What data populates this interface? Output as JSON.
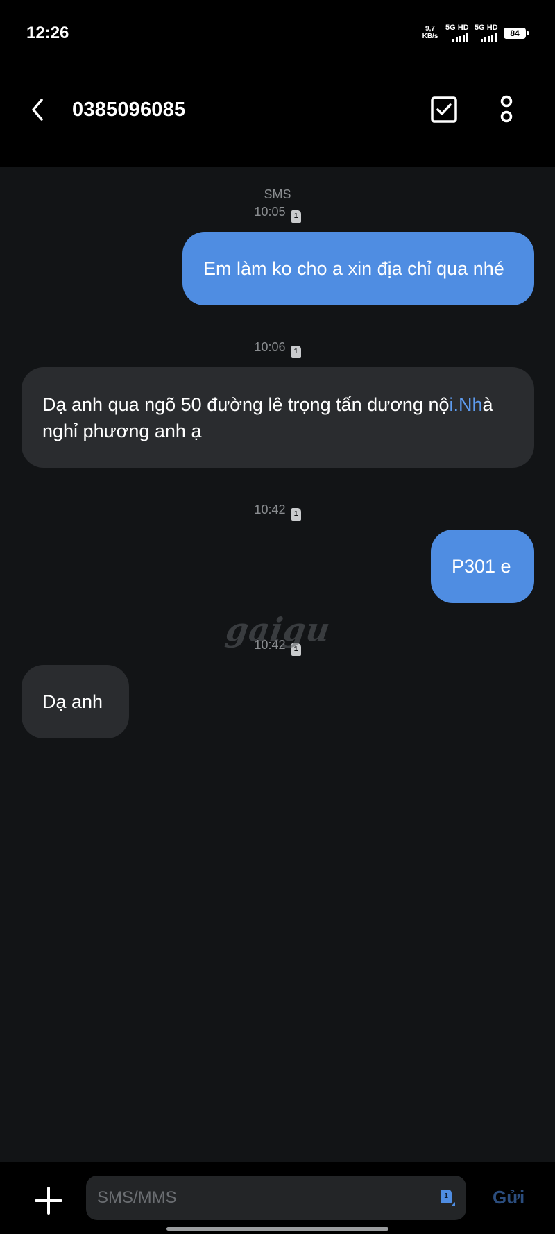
{
  "status_bar": {
    "time": "12:26",
    "speed_value": "9,7",
    "speed_unit": "KB/s",
    "net1": "5G HD",
    "net2": "5G HD",
    "battery": "84"
  },
  "header": {
    "title": "0385096085",
    "back_icon": "chevron-left-icon",
    "select_icon": "checkbox-icon",
    "more_icon": "more-vert-icon"
  },
  "conversation": {
    "type_label": "SMS",
    "sim_label": "1",
    "messages": [
      {
        "time": "10:05",
        "direction": "out",
        "text": "Em làm ko cho a xin địa chỉ qua nhé"
      },
      {
        "time": "10:06",
        "direction": "in",
        "text_before": "Dạ anh qua ngõ 50 đường lê trọng tấn dương nộ",
        "link": "i.Nh",
        "text_after": "à",
        "line2": "nghỉ phương anh ạ"
      },
      {
        "time": "10:42",
        "direction": "out",
        "text": "P301 e"
      },
      {
        "time": "10:42",
        "direction": "in",
        "text": "Dạ anh"
      }
    ]
  },
  "watermark": "gaigu",
  "composer": {
    "placeholder": "SMS/MMS",
    "sim": "1",
    "send_label": "Gửi"
  },
  "colors": {
    "background": "#121416",
    "outgoing_bubble": "#4f8de2",
    "incoming_bubble": "#2a2c2f",
    "link": "#5e9cf0"
  }
}
